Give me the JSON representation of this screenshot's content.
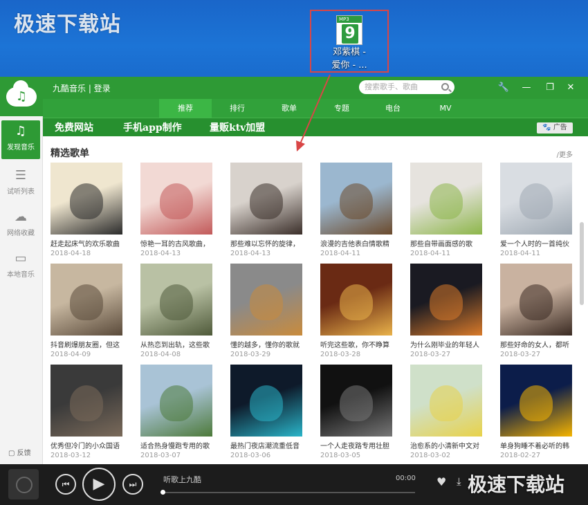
{
  "watermark": "极速下载站",
  "desktop_icon": {
    "file_badge": "MP3",
    "file_number": "9",
    "label_line1": "邓紫棋 -",
    "label_line2": "爱你 - ..."
  },
  "app": {
    "name": "九酷音乐 | 登录",
    "search_placeholder": "搜索歌手、歌曲",
    "window_buttons": [
      "wrench-icon",
      "minimize-icon",
      "restore-icon",
      "close-icon"
    ]
  },
  "nav": {
    "items": [
      "推荐",
      "排行",
      "歌单",
      "专题",
      "电台",
      "MV"
    ],
    "active": "推荐"
  },
  "promo": {
    "links": [
      "免费网站",
      "手机app制作",
      "量贩ktv加盟"
    ],
    "ad_label": "广告"
  },
  "sidebar": {
    "items": [
      {
        "label": "发现音乐",
        "icon": "music-note-icon",
        "active": true
      },
      {
        "label": "试听列表",
        "icon": "list-icon",
        "active": false
      },
      {
        "label": "网络收藏",
        "icon": "cloud-icon",
        "active": false
      },
      {
        "label": "本地音乐",
        "icon": "monitor-icon",
        "active": false
      }
    ],
    "feedback": "反馈"
  },
  "section": {
    "title": "精选歌单",
    "more": "/更多"
  },
  "playlists": [
    {
      "title": "赶走起床气的欢乐歌曲",
      "date": "2018-04-18",
      "c1": "#efe6cf",
      "c2": "#2b2b2b"
    },
    {
      "title": "惊艳一耳的古风歌曲，",
      "date": "2018-04-13",
      "c1": "#f2d9d4",
      "c2": "#c25a5a"
    },
    {
      "title": "那些难以忘怀的旋律，",
      "date": "2018-04-13",
      "c1": "#d8d2cc",
      "c2": "#3b2f2a"
    },
    {
      "title": "浪漫的吉他表白情歌精",
      "date": "2018-04-11",
      "c1": "#9bb7cf",
      "c2": "#6b4a2c"
    },
    {
      "title": "那些自带画面感的歌",
      "date": "2018-04-11",
      "c1": "#e6e3de",
      "c2": "#8db64a"
    },
    {
      "title": "爱一个人时的一首纯伙",
      "date": "2018-04-11",
      "c1": "#d9dde2",
      "c2": "#9ea8b2"
    },
    {
      "title": "抖音刷爆朋友圈，但这",
      "date": "2018-04-09",
      "c1": "#c7b7a0",
      "c2": "#5a4a3a"
    },
    {
      "title": "从热恋到出轨，这些歌",
      "date": "2018-04-08",
      "c1": "#b9c1a4",
      "c2": "#4f5a3a"
    },
    {
      "title": "懂的越多，懂你的歌就",
      "date": "2018-03-29",
      "c1": "#8a8a8a",
      "c2": "#c98b3c"
    },
    {
      "title": "听完这些歌，你不睁算",
      "date": "2018-03-28",
      "c1": "#6a2a14",
      "c2": "#e9b24a"
    },
    {
      "title": "为什么刚毕业的年轻人",
      "date": "2018-03-27",
      "c1": "#1a1a22",
      "c2": "#d97a2a"
    },
    {
      "title": "那些好命的女人，都听",
      "date": "2018-03-27",
      "c1": "#c9b2a0",
      "c2": "#3a2a22"
    },
    {
      "title": "优秀但冷门的小众国语",
      "date": "2018-03-12",
      "c1": "#3a3a3a",
      "c2": "#7a6a5a"
    },
    {
      "title": "适合热身慢跑专用的歌",
      "date": "2018-03-07",
      "c1": "#a9c3d6",
      "c2": "#4d7a3a"
    },
    {
      "title": "最热门夜店潮流重低音",
      "date": "2018-03-06",
      "c1": "#0e1a2a",
      "c2": "#2ab5c9"
    },
    {
      "title": "一个人走夜路专用壮胆",
      "date": "2018-03-05",
      "c1": "#111111",
      "c2": "#777777"
    },
    {
      "title": "治愈系的小清新中文对",
      "date": "2018-03-02",
      "c1": "#cfe0c9",
      "c2": "#e8d24a"
    },
    {
      "title": "单身狗睡不着必听的韩",
      "date": "2018-02-27",
      "c1": "#0c1d4a",
      "c2": "#f5b400"
    }
  ],
  "player": {
    "track": "听歌上九酷",
    "time": "00:00",
    "progress": 0
  },
  "colors": {
    "brand_green": "#2e9a35",
    "desktop_blue": "#1a66c9",
    "player_bg": "#1c1c1c",
    "annotation_red": "#d94646"
  }
}
